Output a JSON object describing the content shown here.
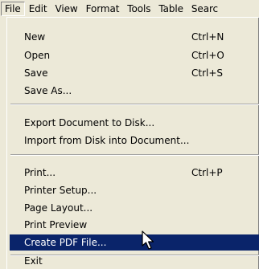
{
  "menubar": {
    "items": [
      {
        "label": "File"
      },
      {
        "label": "Edit"
      },
      {
        "label": "View"
      },
      {
        "label": "Format"
      },
      {
        "label": "Tools"
      },
      {
        "label": "Table"
      },
      {
        "label": "Searc"
      }
    ]
  },
  "file_menu": {
    "items": [
      {
        "label": "New",
        "shortcut": "Ctrl+N"
      },
      {
        "label": "Open",
        "shortcut": "Ctrl+O"
      },
      {
        "label": "Save",
        "shortcut": "Ctrl+S"
      },
      {
        "label": "Save As..."
      },
      {
        "label": "Export Document to Disk..."
      },
      {
        "label": "Import from Disk into Document..."
      },
      {
        "label": "Print...",
        "shortcut": "Ctrl+P"
      },
      {
        "label": "Printer Setup..."
      },
      {
        "label": "Page Layout..."
      },
      {
        "label": "Print Preview"
      },
      {
        "label": "Create PDF File..."
      },
      {
        "label": "Exit"
      }
    ]
  },
  "colors": {
    "menu_bg": "#ece9d8",
    "highlight_bg": "#0a246a",
    "highlight_text": "#ffffff"
  },
  "icons": {
    "cursor": "mouse-pointer-icon"
  }
}
